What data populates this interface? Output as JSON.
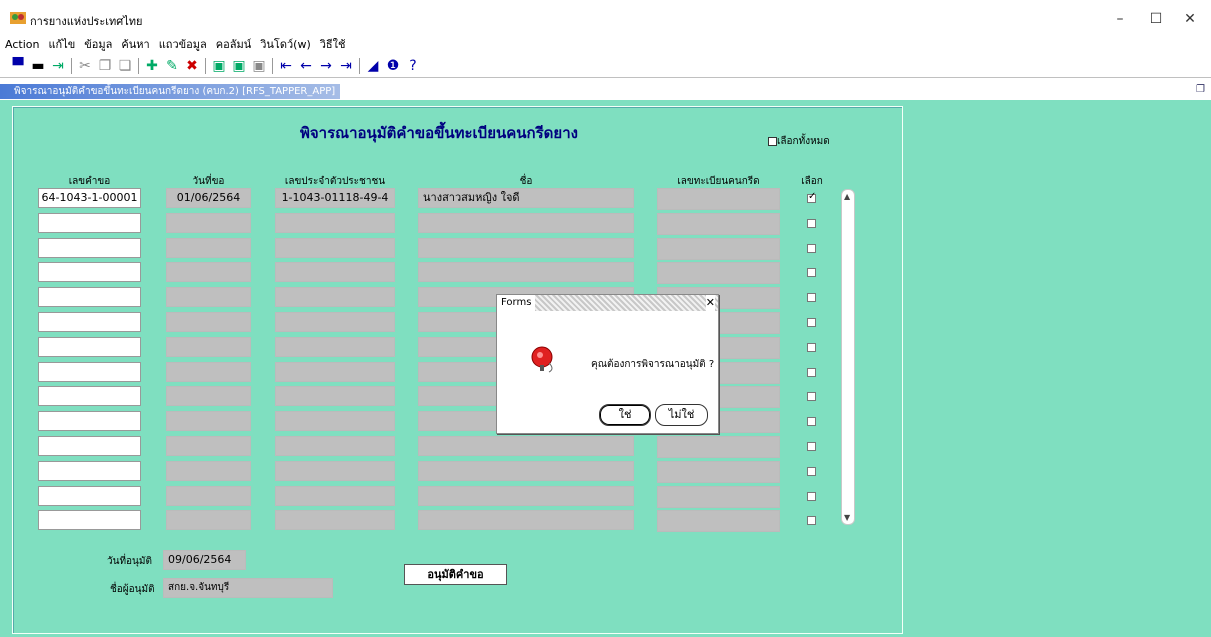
{
  "window": {
    "title": "การยางแห่งประเทศไทย",
    "min": "–",
    "max": "☐",
    "close": "✕"
  },
  "menu": [
    "Action",
    "แก้ไข",
    "ข้อมูล",
    "ค้นหา",
    "แถวข้อมูล",
    "คอลัมน์",
    "วินโดว์(w)",
    "วิธีใช้"
  ],
  "form_window": {
    "title": "พิจารณาอนุมัติคำขอขึ้นทะเบียนคนกรีดยาง (คบก.2) [RFS_TAPPER_APP]"
  },
  "page": {
    "heading": "พิจารณาอนุมัติคำขอขึ้นทะเบียนคนกรีดยาง",
    "select_all_label": "เลือกทั้งหมด",
    "columns": [
      "เลขคำขอ",
      "วันที่ขอ",
      "เลขประจำตัวประชาชน",
      "ชื่อ",
      "เลขทะเบียนคนกรีด",
      "เลือก"
    ],
    "rows": [
      {
        "req_no": "64-1043-1-00001",
        "req_date": "01/06/2564",
        "citizen_id": "1-1043-01118-49-4",
        "name": "นางสาวสมหญิง ใจดี",
        "reg_no": "",
        "selected": true
      },
      {
        "req_no": "",
        "req_date": "",
        "citizen_id": "",
        "name": "",
        "reg_no": "",
        "selected": false
      },
      {
        "req_no": "",
        "req_date": "",
        "citizen_id": "",
        "name": "",
        "reg_no": "",
        "selected": false
      },
      {
        "req_no": "",
        "req_date": "",
        "citizen_id": "",
        "name": "",
        "reg_no": "",
        "selected": false
      },
      {
        "req_no": "",
        "req_date": "",
        "citizen_id": "",
        "name": "",
        "reg_no": "",
        "selected": false
      },
      {
        "req_no": "",
        "req_date": "",
        "citizen_id": "",
        "name": "",
        "reg_no": "",
        "selected": false
      },
      {
        "req_no": "",
        "req_date": "",
        "citizen_id": "",
        "name": "",
        "reg_no": "",
        "selected": false
      },
      {
        "req_no": "",
        "req_date": "",
        "citizen_id": "",
        "name": "",
        "reg_no": "",
        "selected": false
      },
      {
        "req_no": "",
        "req_date": "",
        "citizen_id": "",
        "name": "",
        "reg_no": "",
        "selected": false
      },
      {
        "req_no": "",
        "req_date": "",
        "citizen_id": "",
        "name": "",
        "reg_no": "",
        "selected": false
      },
      {
        "req_no": "",
        "req_date": "",
        "citizen_id": "",
        "name": "",
        "reg_no": "",
        "selected": false
      },
      {
        "req_no": "",
        "req_date": "",
        "citizen_id": "",
        "name": "",
        "reg_no": "",
        "selected": false
      },
      {
        "req_no": "",
        "req_date": "",
        "citizen_id": "",
        "name": "",
        "reg_no": "",
        "selected": false
      },
      {
        "req_no": "",
        "req_date": "",
        "citizen_id": "",
        "name": "",
        "reg_no": "",
        "selected": false
      }
    ],
    "approve_date_label": "วันที่อนุมัติ",
    "approve_date": "09/06/2564",
    "approver_label": "ชื่อผู้อนุมัติ",
    "approver": "สกย.จ.จันทบุรี",
    "approve_button": "อนุมัติคำขอ"
  },
  "dialog": {
    "title": "Forms",
    "message": "คุณต้องการพิจารณาอนุมัติ ?",
    "yes": "ใช่",
    "no": "ไม่ใช่",
    "close": "✕"
  },
  "colors": {
    "form_bg": "#7fdfc0",
    "heading": "#000080",
    "field_disabled": "#bfbfbf"
  }
}
